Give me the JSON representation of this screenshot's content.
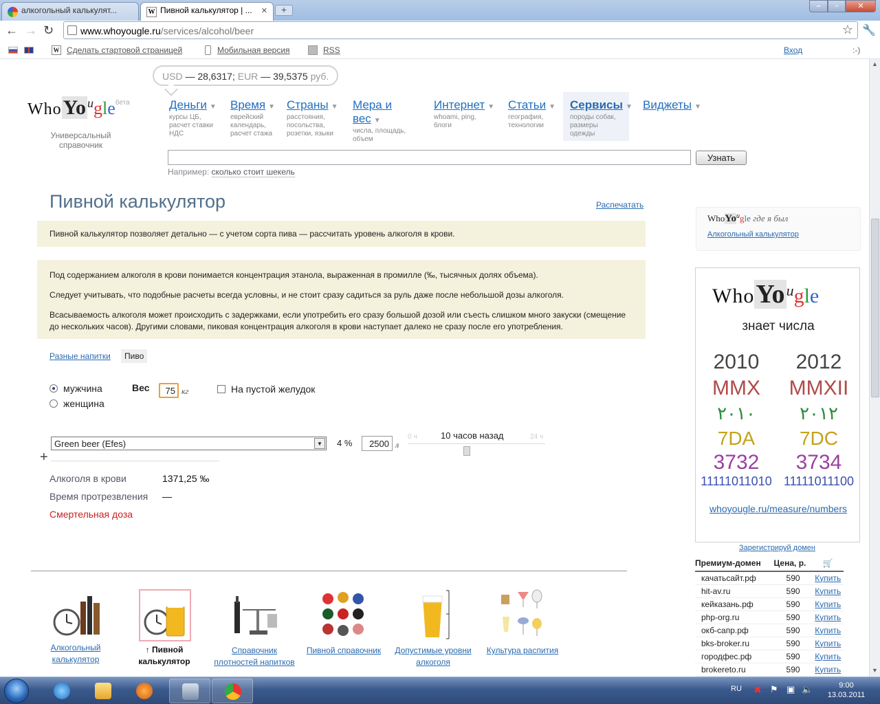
{
  "browser": {
    "tabs": [
      {
        "label": "алкогольный калькулят...",
        "active": false
      },
      {
        "label": "Пивной калькулятор | ...",
        "active": true
      }
    ],
    "url_host": "www.whoyougle.ru",
    "url_path": "/services/alcohol/beer"
  },
  "bookmarks": {
    "start_page": "Сделать стартовой страницей",
    "mobile": "Мобильная версия",
    "rss": "RSS",
    "login": "Вход",
    "smiley": ":-)"
  },
  "currency": {
    "usd_label": "USD",
    "usd_value": "— 28,6317",
    "sep": ";",
    "eur_label": "EUR",
    "eur_value": "— 39,5375",
    "unit": "руб."
  },
  "logo": {
    "who": "Who",
    "yo": "Yo",
    "u": "u",
    "g": "g",
    "l": "l",
    "e": "e",
    "beta": "бета",
    "subtitle": "Универсальный справочник"
  },
  "nav": [
    {
      "title": "Деньги",
      "desc": "курсы ЦБ, расчет ставки НДС"
    },
    {
      "title": "Время",
      "desc": "еврейский календарь, расчет стажа"
    },
    {
      "title": "Страны",
      "desc": "расстояния, посольства, розетки, языки"
    },
    {
      "title": "Мера и вес",
      "desc": "числа, площадь, объем"
    },
    {
      "title": "Интернет",
      "desc": "whoami, ping, блоги"
    },
    {
      "title": "Статьи",
      "desc": "география, технологии"
    },
    {
      "title": "Сервисы",
      "desc": "породы собак, размеры одежды"
    },
    {
      "title": "Виджеты",
      "desc": ""
    }
  ],
  "search": {
    "button": "Узнать",
    "example_prefix": "Например:",
    "example_link": "сколько стоит шекель"
  },
  "page": {
    "title": "Пивной калькулятор",
    "print": "Распечатать",
    "intro": "Пивной калькулятор позволяет детально — с учетом сорта пива — рассчитать уровень алкоголя в крови.",
    "info": [
      "Под содержанием алкоголя в крови понимается концентрация этанола, выраженная в промилле (‰, тысячных долях объема).",
      "Следует учитывать, что подобные расчеты всегда условны, и не стоит сразу садиться за руль даже после небольшой дозы алкоголя.",
      "Всасываемость алкоголя может происходить с задержками, если употребить его сразу большой дозой или съесть слишком много закуски (смещение до нескольких часов). Другими словами, пиковая концентрация алкоголя в крови наступает далеко не сразу после его употребления."
    ]
  },
  "calculator": {
    "tab_other": "Разные напитки",
    "tab_beer": "Пиво",
    "male": "мужчина",
    "female": "женщина",
    "weight_label": "Вес",
    "weight_value": "75",
    "weight_unit": "кг",
    "empty_stomach": "На пустой желудок",
    "beer": "Green beer (Efes)",
    "strength": "4 %",
    "volume": "2500",
    "volume_unit": "л",
    "time_min": "0 ч",
    "time_max": "24 ч",
    "time_label": "10 часов назад",
    "time_position": 0.43,
    "result_label": "Алкоголя в крови",
    "result_value": "1371,25 ‰",
    "sober_label": "Время протрезвления",
    "sober_value": "—",
    "lethal_label": "Смертельная доза"
  },
  "services": [
    {
      "caption": "Алкогольный калькулятор",
      "current": false
    },
    {
      "caption": "↑ Пивной калькулятор",
      "current": true
    },
    {
      "caption": "Справочник плотностей напитков",
      "current": false
    },
    {
      "caption": "Пивной справочник",
      "current": false
    },
    {
      "caption": "Допустимые уровни алкоголя",
      "current": false
    },
    {
      "caption": "Культура распития",
      "current": false
    }
  ],
  "sidebar": {
    "where_tag": "где я был",
    "where_link": "Алкогольный калькулятор",
    "ad_tagline": "знает числа",
    "ad_rows": [
      {
        "a": "2010",
        "b": "2012",
        "color": "#444444"
      },
      {
        "a": "MMX",
        "b": "MMXII",
        "color": "#b04a4a"
      },
      {
        "a": "٢٠١٠",
        "b": "٢٠١٢",
        "color": "#2a8a3a"
      },
      {
        "a": "7DA",
        "b": "7DC",
        "color": "#c4a21a"
      },
      {
        "a": "3732",
        "b": "3734",
        "color": "#9a3fa0"
      },
      {
        "a": "11111011010",
        "b": "11111011100",
        "color": "#3a4fb0"
      }
    ],
    "ad_link": "whoyougle.ru/measure/numbers",
    "register": "Зарегистрируй домен"
  },
  "domains": {
    "col_name": "Премиум-домен",
    "col_price": "Цена, р.",
    "buy": "Купить",
    "rows": [
      {
        "name": "качатьсайт.рф",
        "price": "590"
      },
      {
        "name": "hit-av.ru",
        "price": "590"
      },
      {
        "name": "кейказань.рф",
        "price": "590"
      },
      {
        "name": "php-org.ru",
        "price": "590"
      },
      {
        "name": "окб-сапр.рф",
        "price": "590"
      },
      {
        "name": "bks-broker.ru",
        "price": "590"
      },
      {
        "name": "городфес.рф",
        "price": "590"
      },
      {
        "name": "brokereto.ru",
        "price": "590"
      }
    ]
  },
  "taskbar": {
    "lang": "RU",
    "time": "9:00",
    "date": "13.03.2011"
  }
}
